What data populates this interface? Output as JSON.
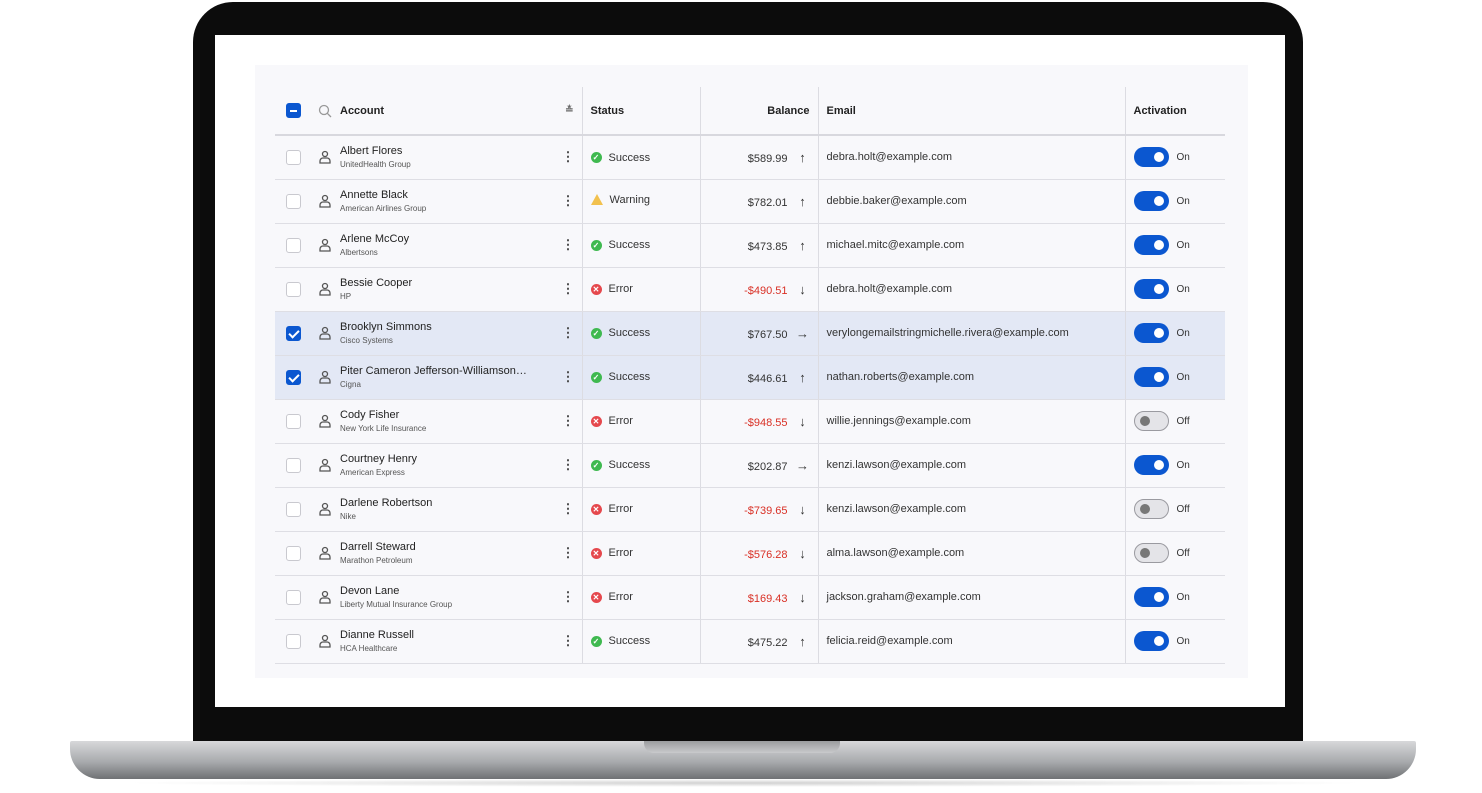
{
  "colors": {
    "accent": "#0b57d0",
    "success": "#3fb950",
    "warning": "#f2c14e",
    "error": "#e5484d",
    "negative": "#d93025"
  },
  "header": {
    "account": "Account",
    "status": "Status",
    "balance": "Balance",
    "email": "Email",
    "activation": "Activation",
    "select_all": "indeterminate"
  },
  "rows": [
    {
      "name": "Albert Flores",
      "org": "UnitedHealth Group",
      "status": "Success",
      "balance": "$589.99",
      "trend": "up",
      "email": "debra.holt@example.com",
      "active": true,
      "label": "On",
      "checked": false
    },
    {
      "name": "Annette Black",
      "org": "American Airlines Group",
      "status": "Warning",
      "balance": "$782.01",
      "trend": "up",
      "email": "debbie.baker@example.com",
      "active": true,
      "label": "On",
      "checked": false
    },
    {
      "name": "Arlene McCoy",
      "org": "Albertsons",
      "status": "Success",
      "balance": "$473.85",
      "trend": "up",
      "email": "michael.mitc@example.com",
      "active": true,
      "label": "On",
      "checked": false
    },
    {
      "name": "Bessie Cooper",
      "org": "HP",
      "status": "Error",
      "balance": "-$490.51",
      "trend": "down",
      "email": "debra.holt@example.com",
      "active": true,
      "label": "On",
      "checked": false
    },
    {
      "name": "Brooklyn Simmons",
      "org": "Cisco Systems",
      "status": "Success",
      "balance": "$767.50",
      "trend": "right",
      "email": "verylongemailstringmichelle.rivera@example.com",
      "active": true,
      "label": "On",
      "checked": true
    },
    {
      "name": "Piter Cameron Jefferson-Williamson…",
      "org": "Cigna",
      "status": "Success",
      "balance": "$446.61",
      "trend": "up",
      "email": "nathan.roberts@example.com",
      "active": true,
      "label": "On",
      "checked": true
    },
    {
      "name": "Cody Fisher",
      "org": "New York Life Insurance",
      "status": "Error",
      "balance": "-$948.55",
      "trend": "down",
      "email": "willie.jennings@example.com",
      "active": false,
      "label": "Off",
      "checked": false
    },
    {
      "name": "Courtney Henry",
      "org": "American Express",
      "status": "Success",
      "balance": "$202.87",
      "trend": "right",
      "email": "kenzi.lawson@example.com",
      "active": true,
      "label": "On",
      "checked": false
    },
    {
      "name": "Darlene Robertson",
      "org": "Nike",
      "status": "Error",
      "balance": "-$739.65",
      "trend": "down",
      "email": "kenzi.lawson@example.com",
      "active": false,
      "label": "Off",
      "checked": false
    },
    {
      "name": "Darrell Steward",
      "org": "Marathon Petroleum",
      "status": "Error",
      "balance": "-$576.28",
      "trend": "down",
      "email": "alma.lawson@example.com",
      "active": false,
      "label": "Off",
      "checked": false
    },
    {
      "name": "Devon Lane",
      "org": "Liberty Mutual Insurance Group",
      "status": "Error",
      "balance": "$169.43",
      "trend": "down",
      "email": "jackson.graham@example.com",
      "active": true,
      "label": "On",
      "checked": false
    },
    {
      "name": "Dianne Russell",
      "org": "HCA Healthcare",
      "status": "Success",
      "balance": "$475.22",
      "trend": "up",
      "email": "felicia.reid@example.com",
      "active": true,
      "label": "On",
      "checked": false
    }
  ]
}
